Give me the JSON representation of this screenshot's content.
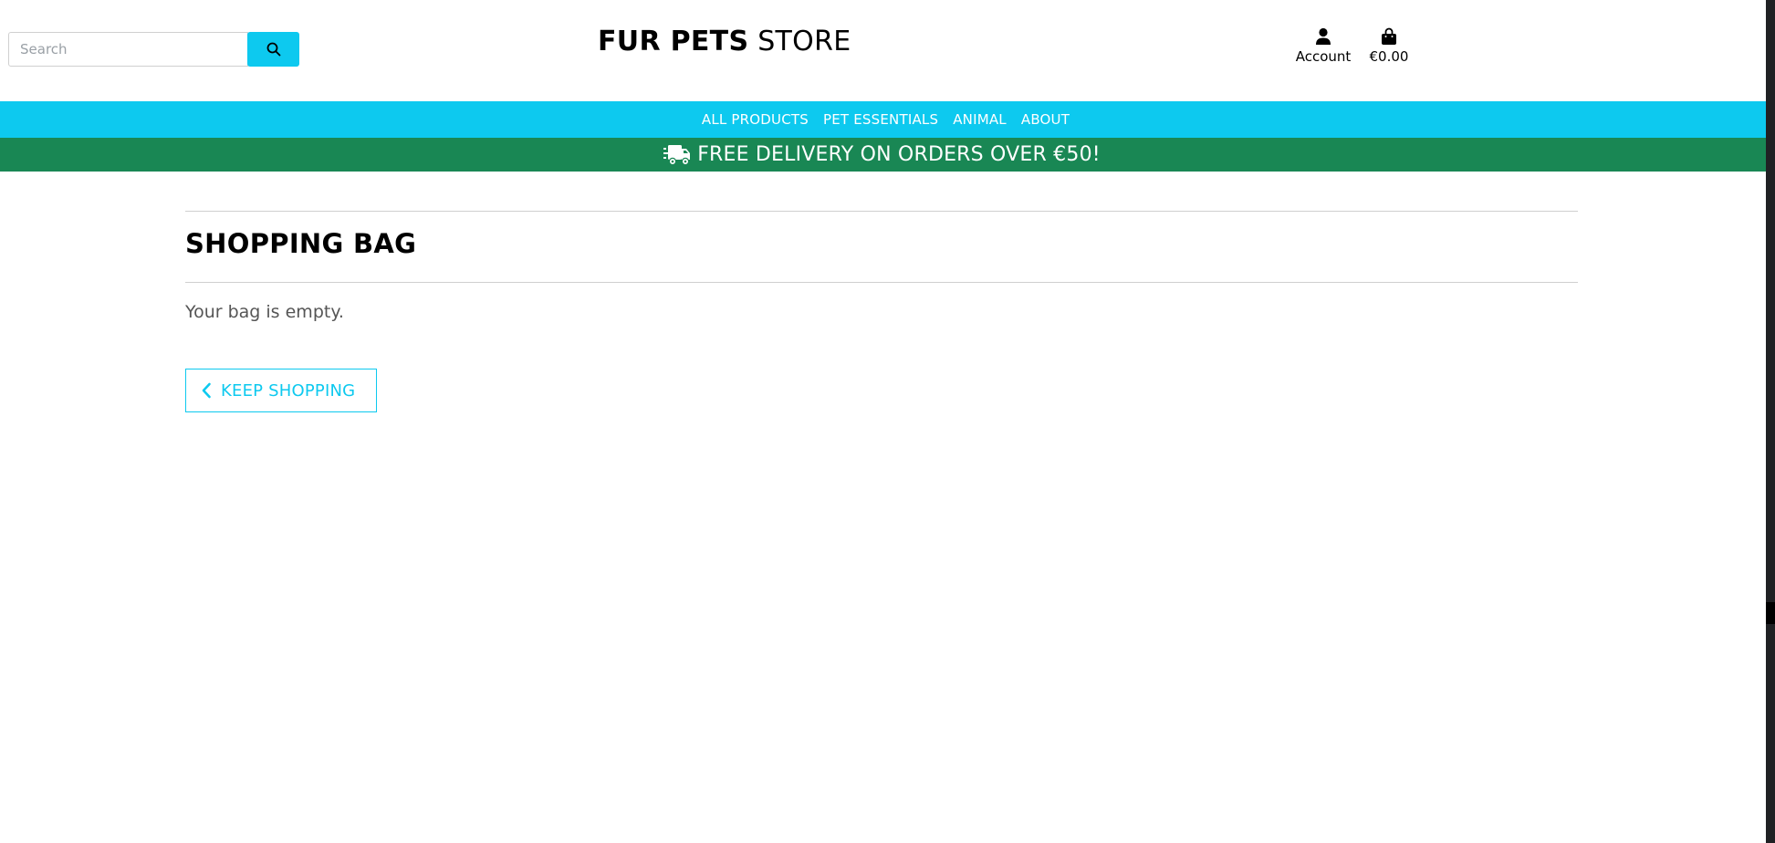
{
  "header": {
    "search": {
      "placeholder": "Search"
    },
    "logo": {
      "bold": "FUR PETS",
      "light": "STORE"
    },
    "account": {
      "label": "Account",
      "icon": "user-icon"
    },
    "bag": {
      "total": "€0.00",
      "icon": "shopping-bag-icon"
    }
  },
  "nav": {
    "items": [
      "ALL PRODUCTS",
      "PET ESSENTIALS",
      "ANIMAL",
      "ABOUT"
    ]
  },
  "banner": {
    "text": "FREE DELIVERY ON ORDERS OVER €50!",
    "icon": "shipping-truck-icon"
  },
  "main": {
    "title": "SHOPPING BAG",
    "empty_message": "Your bag is empty.",
    "keep_shopping_label": "KEEP SHOPPING"
  },
  "colors": {
    "accent": "#0dc9ef",
    "banner": "#198754",
    "text": "#000000",
    "muted": "#555555"
  }
}
